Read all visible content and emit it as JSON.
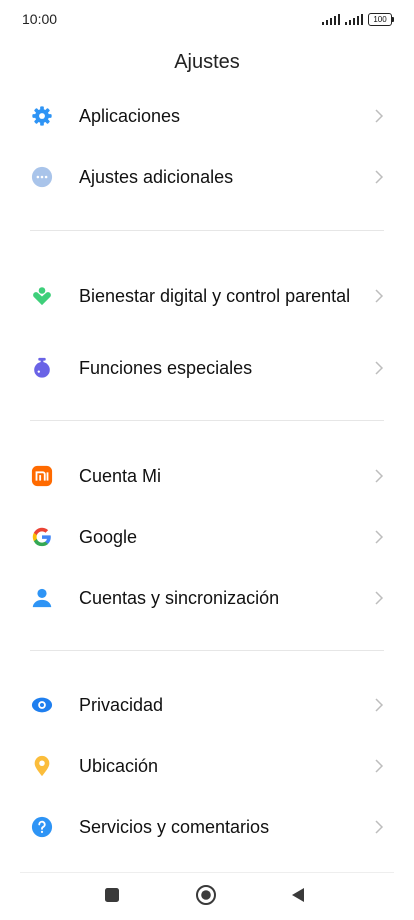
{
  "status_bar": {
    "time": "10:00",
    "battery": "100"
  },
  "title": "Ajustes",
  "items": [
    {
      "label": "Aplicaciones"
    },
    {
      "label": "Ajustes adicionales"
    },
    {
      "label": "Bienestar digital y control parental"
    },
    {
      "label": "Funciones especiales"
    },
    {
      "label": "Cuenta Mi"
    },
    {
      "label": "Google"
    },
    {
      "label": "Cuentas y sincronización"
    },
    {
      "label": "Privacidad"
    },
    {
      "label": "Ubicación"
    },
    {
      "label": "Servicios y comentarios"
    }
  ],
  "colors": {
    "blue": "#2e94f5",
    "light_blue": "#a9c4ea",
    "green": "#3ecf7a",
    "purple": "#6a63e6",
    "orange": "#ff6a00",
    "yellow": "#fbbd3b"
  },
  "icons": [
    "gear-icon",
    "more-dots-icon",
    "wellbeing-icon",
    "special-features-icon",
    "mi-logo-icon",
    "google-icon",
    "account-icon",
    "eye-icon",
    "location-pin-icon",
    "help-icon"
  ]
}
